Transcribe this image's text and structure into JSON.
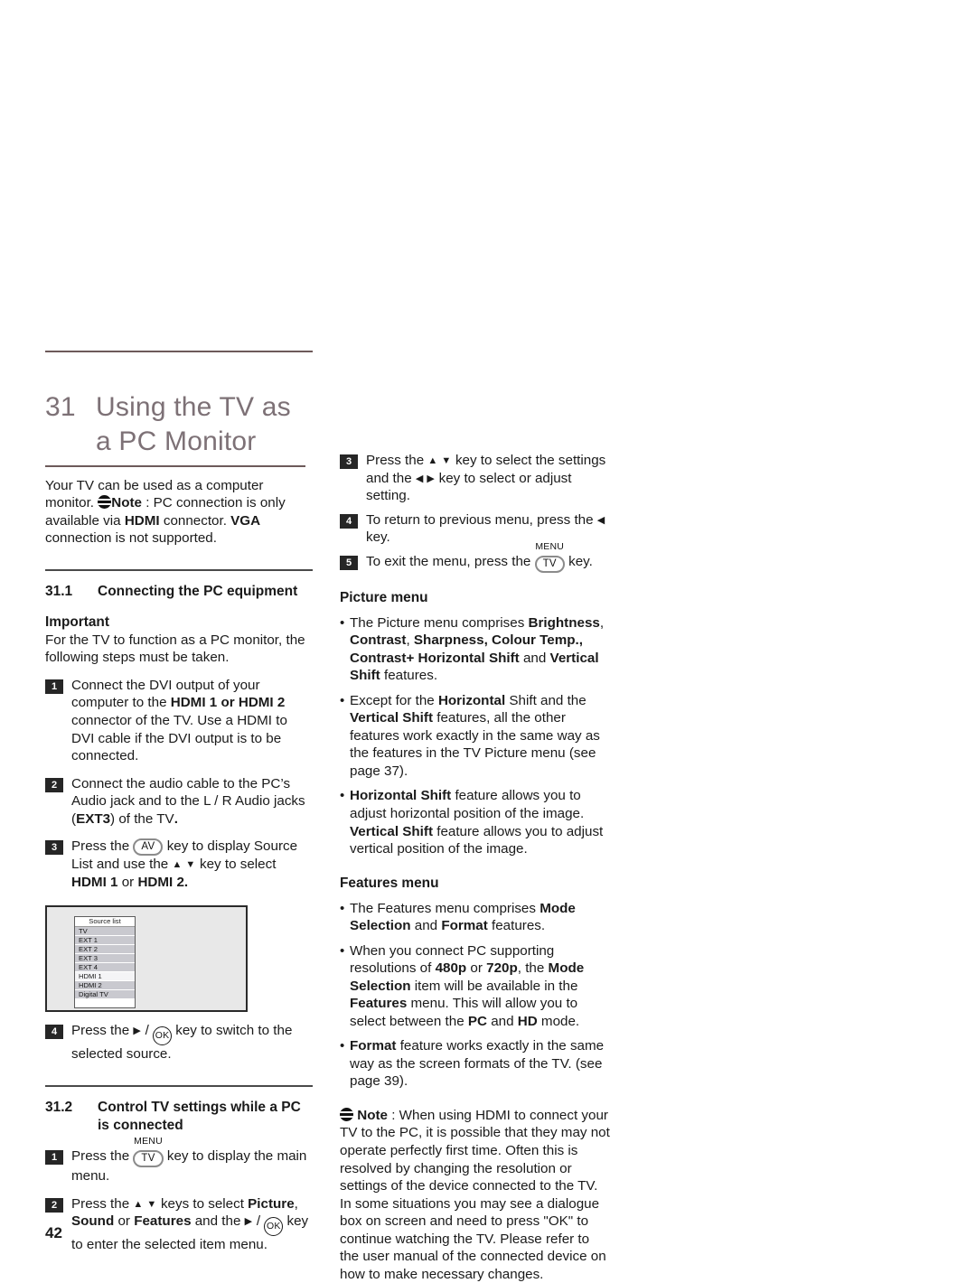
{
  "page": {
    "number": "42"
  },
  "chapter": {
    "number": "31",
    "title": "Using the TV as a PC Monitor"
  },
  "intro": {
    "part1": "Your TV can be used as a computer monitor. ",
    "note_label": "Note",
    "part2": " : PC connection is only available via ",
    "hdmi": "HDMI",
    "part3": " connector. ",
    "vga": "VGA",
    "part4": " connection is not supported.",
    "note_icon": "note-icon"
  },
  "section_31_1": {
    "number": "31.1",
    "title": "Connecting the PC equipment",
    "important_heading": "Important",
    "important_text": "For the TV to function as a PC monitor, the following steps must be taken.",
    "steps": [
      {
        "num": "1",
        "text_a": "Connect the DVI output of your computer to the ",
        "bold_a": "HDMI 1 or HDMI 2",
        "text_b": " connector of the TV. Use a HDMI to DVI cable if the DVI output is to be connected."
      },
      {
        "num": "2",
        "text_a": "Connect the audio cable to the PC’s Audio jack and to the L / R Audio jacks (",
        "bold_a": "EXT3",
        "text_b": ") of the TV",
        "bold_b": "."
      },
      {
        "num": "3",
        "text_a": "Press the ",
        "key": "AV",
        "text_b": " key to display Source List  and use the ",
        "arrows": "▲ ▼",
        "text_c": " key to select ",
        "bold_a": "HDMI 1",
        "text_d": " or ",
        "bold_b": "HDMI 2."
      },
      {
        "num": "4",
        "text_a": "Press the ",
        "arrow": "▶",
        "text_b": " / ",
        "key": "OK",
        "text_c": " key to switch to the selected source."
      }
    ]
  },
  "figure": {
    "name": "source-list-osd",
    "header": "Source list",
    "rows": [
      {
        "label": "TV",
        "selected": false
      },
      {
        "label": "EXT 1",
        "selected": false
      },
      {
        "label": "EXT 2",
        "selected": false
      },
      {
        "label": "EXT 3",
        "selected": false
      },
      {
        "label": "EXT 4",
        "selected": false
      },
      {
        "label": "HDMI 1",
        "selected": true
      },
      {
        "label": "HDMI 2",
        "selected": false
      },
      {
        "label": "Digital TV",
        "selected": false
      }
    ]
  },
  "section_31_2": {
    "number": "31.2",
    "title": "Control TV settings while a PC is connected",
    "steps": [
      {
        "num": "1",
        "text_a": "Press the ",
        "key_label": "MENU",
        "key": "TV",
        "text_b": " key to display the main menu."
      },
      {
        "num": "2",
        "text_a": "Press the ",
        "arrows": "▲ ▼",
        "text_b": " keys to select ",
        "bold_a": "Picture",
        "text_c": ", ",
        "bold_b": "Sound",
        "text_d": " or ",
        "bold_c": "Features",
        "text_e": " and the ",
        "arrow": "▶",
        "text_f": " / ",
        "key2": "OK",
        "text_g": " key to enter the selected item menu."
      }
    ]
  },
  "right_steps": [
    {
      "num": "3",
      "text_a": "Press the ",
      "arrows": "▲ ▼",
      "text_b": " key to select the settings and the ",
      "arrows2": "◀  ▶",
      "text_c": " key to select or adjust setting."
    },
    {
      "num": "4",
      "text_a": "To return to previous menu, press the ",
      "arrow": "◀",
      "text_b": " key."
    },
    {
      "num": "5",
      "text_a": "To exit the menu, press the ",
      "key_label": "MENU",
      "key": "TV",
      "text_b": " key."
    }
  ],
  "picture_menu": {
    "heading": "Picture menu",
    "bullets": [
      {
        "text_a": "The Picture menu comprises ",
        "bold_a": "Brightness",
        "text_b": ", ",
        "bold_b": "Contrast",
        "text_c": ", ",
        "bold_c": "Sharpness, Colour Temp., Contrast+ Horizontal Shift",
        "text_d": " and ",
        "bold_d": "Vertical Shift",
        "text_e": " features."
      },
      {
        "text_a": "Except for the ",
        "bold_a": "Horizontal",
        "text_b": " Shift and the ",
        "bold_b": "Vertical Shift",
        "text_c": " features, all the other features work exactly in the same way as the features in the TV Picture menu (see page 37)."
      },
      {
        "bold_a": "Horizontal Shift",
        "text_a": " feature allows you to adjust horizontal position of the image. ",
        "bold_b": "Vertical Shift",
        "text_b": " feature allows you to adjust vertical position of the image."
      }
    ]
  },
  "features_menu": {
    "heading": "Features menu",
    "bullets": [
      {
        "text_a": "The Features menu comprises ",
        "bold_a": "Mode Selection",
        "text_b": " and ",
        "bold_b": "Format",
        "text_c": " features."
      },
      {
        "text_a": "When you connect PC supporting resolutions of ",
        "bold_a": "480p",
        "text_b": " or ",
        "bold_b": "720p",
        "text_c": ", the ",
        "bold_c": "Mode Selection",
        "text_d": " item will be available in the ",
        "bold_d": "Features",
        "text_e": " menu. This will allow you to select between the ",
        "bold_e": "PC",
        "text_f": " and ",
        "bold_f": "HD",
        "text_g": " mode."
      },
      {
        "bold_a": "Format",
        "text_a": " feature works exactly in the same way as the screen formats of the TV. (see page 39)."
      }
    ]
  },
  "final_note": {
    "label": "Note",
    "separator": " : ",
    "text": "When using HDMI to connect your TV to the PC, it is possible that they may not operate perfectly first time. Often this is resolved by changing the resolution or settings of the device connected to the TV.  In some situations you may see a dialogue box on screen and need to press \"OK\" to continue watching the TV.  Please refer to the user manual of the connected device on how to make necessary changes."
  },
  "colors": {
    "rule_title": "#6d5a5a",
    "rule_section": "#4a4a4a",
    "chapter_title": "#7d7176",
    "step_badge": "#262626",
    "figure_bg": "#e8e8e8",
    "osd_row": "#c9c9cf",
    "osd_selected": "#f4f4f6"
  }
}
